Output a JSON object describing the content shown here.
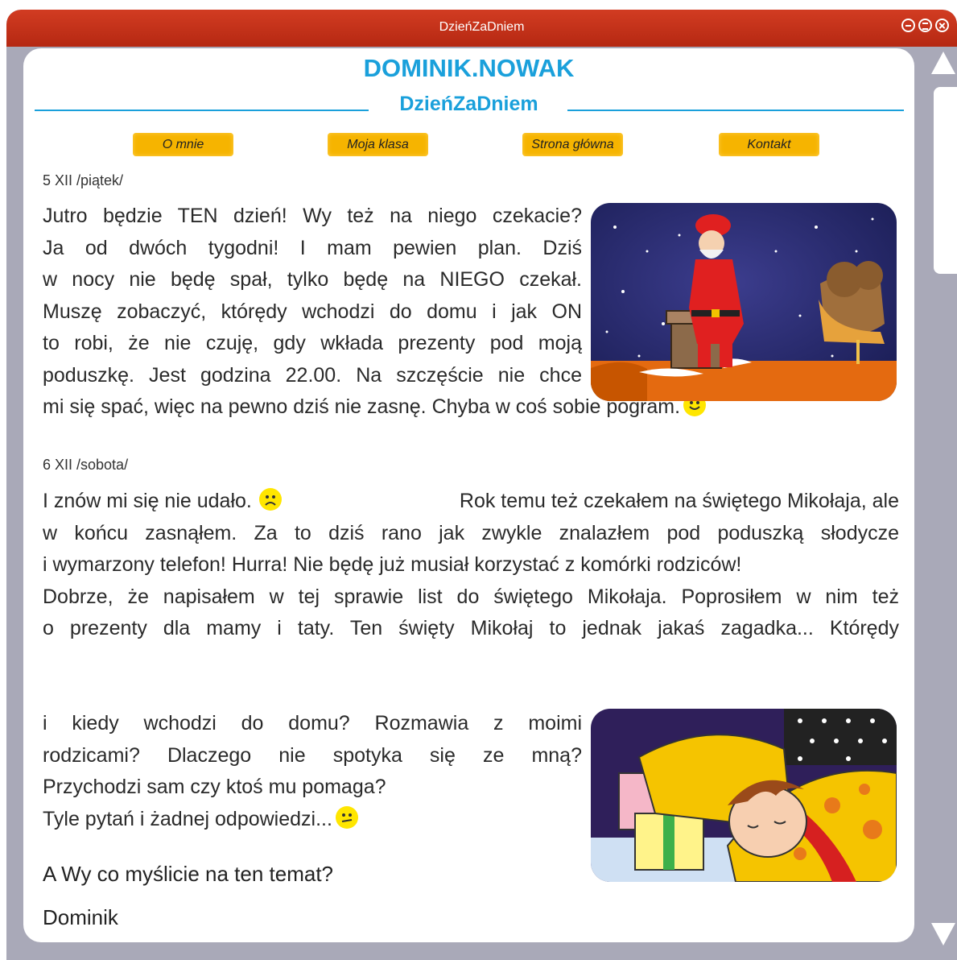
{
  "window": {
    "title": "DzieńZaDniem"
  },
  "header": {
    "site_title": "DOMINIK.NOWAK",
    "subtitle": "DzieńZaDniem"
  },
  "nav": [
    "O mnie",
    "Moja klasa",
    "Strona główna",
    "Kontakt"
  ],
  "post1": {
    "date": "5 XII /piątek/",
    "lines": [
      "Jutro będzie TEN dzień! Wy też na niego czekacie?",
      "Ja od dwóch tygodni! I mam pewien plan. Dziś",
      "w nocy nie będę spał, tylko będę na NIEGO czekał.",
      "Muszę zobaczyć, którędy wchodzi do domu i jak ON",
      "to robi, że nie czuję, gdy wkłada prezenty pod moją",
      "poduszkę. Jest godzina 22.00. Na szczęście nie chce"
    ],
    "last_line": "mi się spać, więc na pewno dziś nie zasnę. Chyba w coś sobie pogram."
  },
  "post2": {
    "date": "6 XII /sobota/",
    "first_start": "I znów mi się nie udało.",
    "first_end": "Rok temu też czekałem na świętego Mikołaja, ale",
    "lines": [
      "w końcu zasnąłem. Za to dziś rano jak zwykle znalazłem pod poduszką słodycze",
      "i wymarzony telefon! Hurra! Nie będę już musiał korzystać z komórki rodziców!",
      "Dobrze, że napisałem w tej sprawie list do świętego Mikołaja. Poprosiłem w nim też",
      "o prezenty dla mamy i taty. Ten święty Mikołaj to jednak jakaś zagadka... Którędy"
    ],
    "narrow_lines": [
      "i kiedy wchodzi do domu? Rozmawia z moimi",
      "rodzicami? Dlaczego nie spotyka się ze mną?"
    ],
    "short_lines": [
      "Przychodzi sam czy ktoś mu pomaga?",
      "Tyle pytań i żadnej odpowiedzi..."
    ],
    "question": "A Wy co myślicie na ten temat?",
    "signature": "Dominik"
  },
  "emoticons": [
    "smile-icon",
    "sad-icon",
    "confused-icon"
  ],
  "colors": {
    "titlebar": "#c0321a",
    "accent": "#1aa0db",
    "nav": "#f6b400",
    "frame": "#a9a9b8"
  }
}
